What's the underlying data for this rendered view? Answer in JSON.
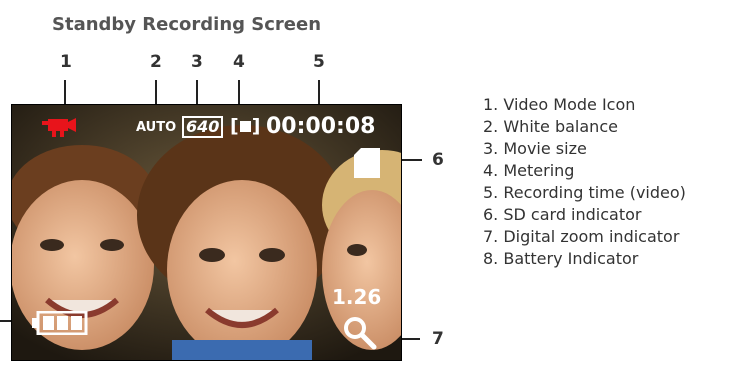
{
  "title": "Standby Recording Screen",
  "callouts": {
    "n1": "1",
    "n2": "2",
    "n3": "3",
    "n4": "4",
    "n5": "5",
    "n6": "6",
    "n7": "7"
  },
  "screen": {
    "wb": "AUTO",
    "movie_size": "640",
    "rec_time": "00:00:08",
    "zoom": "1.26"
  },
  "legend": [
    "1. Video Mode Icon",
    "2. White balance",
    "3. Movie size",
    "4. Metering",
    "5. Recording time (video)",
    "6. SD card indicator",
    "7. Digital zoom indicator",
    "8. Battery Indicator"
  ],
  "colors": {
    "video_icon": "#e8141b",
    "overlay_text": "#ffffff"
  },
  "icons": [
    "video-camera-icon",
    "sd-card-icon",
    "battery-icon",
    "magnifier-icon"
  ]
}
